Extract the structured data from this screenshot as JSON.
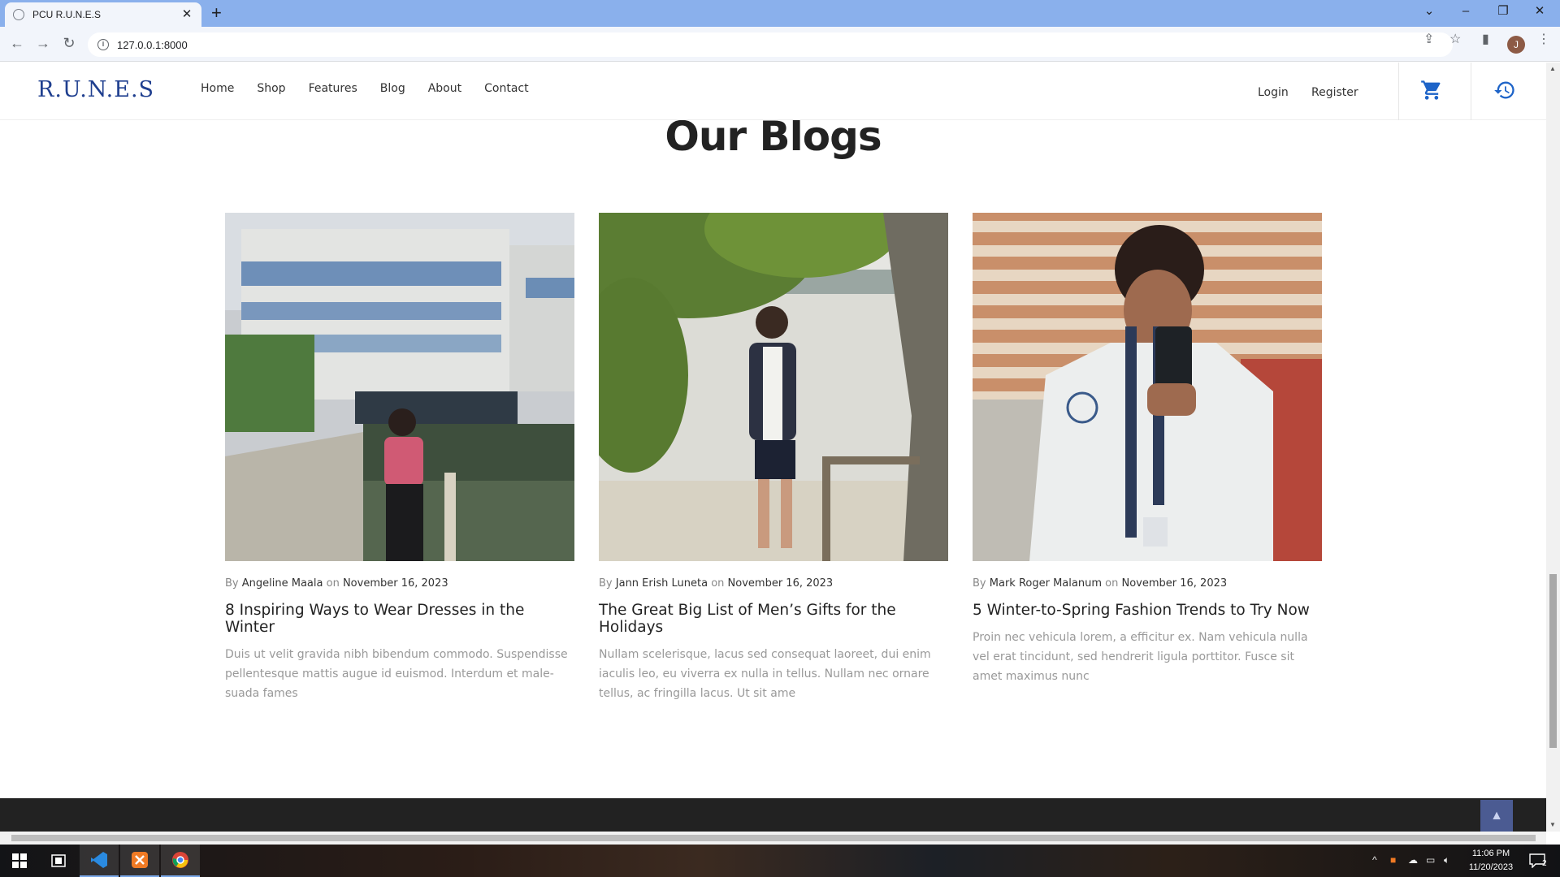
{
  "browser": {
    "tab_title": "PCU R.U.N.E.S",
    "url": "127.0.0.1:8000",
    "profile_initial": "J"
  },
  "site": {
    "brand": "R.U.N.E.S",
    "nav": [
      "Home",
      "Shop",
      "Features",
      "Blog",
      "About",
      "Contact"
    ],
    "login_label": "Login",
    "register_label": "Register",
    "brand_color": "#1f3f8f",
    "accent_color": "#1e64c8"
  },
  "blog": {
    "heading": "Our Blogs",
    "posts": [
      {
        "by": "By",
        "author": "Angeline Maala",
        "on": "on",
        "date": "November 16, 2023",
        "title": "8 Inspiring Ways to Wear Dresses in the Winter",
        "excerpt": "Duis ut velit gravida nibh bibendum commodo. Suspendisse pellentesque mattis augue id euismod. Interdum et male-suada fames"
      },
      {
        "by": "By",
        "author": "Jann Erish Luneta",
        "on": "on",
        "date": "November 16, 2023",
        "title": "The Great Big List of Men’s Gifts for the Holidays",
        "excerpt": "Nullam scelerisque, lacus sed consequat laoreet, dui enim iaculis leo, eu viverra ex nulla in tellus. Nullam nec ornare tellus, ac fringilla lacus. Ut sit ame"
      },
      {
        "by": "By",
        "author": "Mark Roger Malanum",
        "on": "on",
        "date": "November 16, 2023",
        "title": "5 Winter-to-Spring Fashion Trends to Try Now",
        "excerpt": "Proin nec vehicula lorem, a efficitur ex. Nam vehicula nulla vel erat tincidunt, sed hendrerit ligula porttitor. Fusce sit amet maximus nunc"
      }
    ]
  },
  "taskbar": {
    "time": "11:06 PM",
    "date": "11/20/2023",
    "notification_count": "2"
  }
}
